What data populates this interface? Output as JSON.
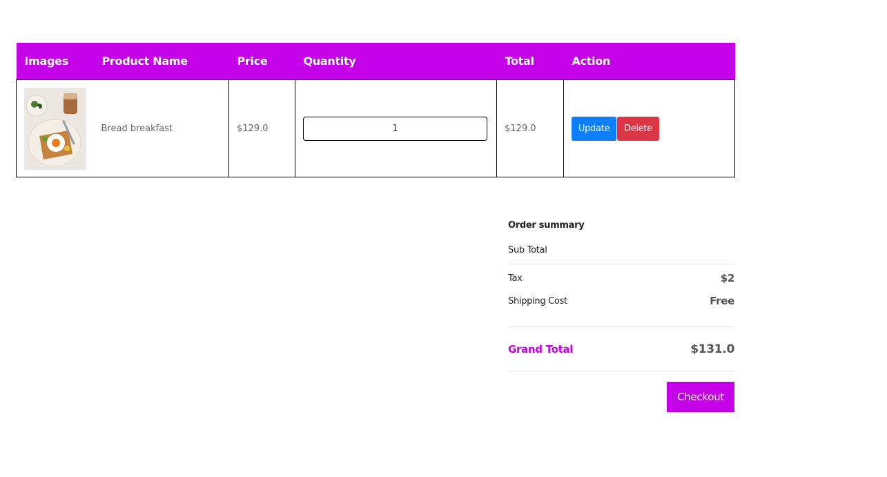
{
  "table": {
    "headers": [
      "Images",
      "Product Name",
      "Price",
      "Quantity",
      "Total",
      "Action"
    ],
    "rows": [
      {
        "image_alt": "Bread breakfast",
        "name": "Bread breakfast",
        "price": "$129.0",
        "quantity": "1",
        "total": "$129.0",
        "update_label": "Update",
        "delete_label": "Delete"
      }
    ]
  },
  "summary": {
    "title": "Order summary",
    "subtotal_label": "Sub Total",
    "subtotal_value": "",
    "tax_label": "Tax",
    "tax_value": "$2",
    "shipping_label": "Shipping Cost",
    "shipping_value": "Free",
    "grand_total_label": "Grand Total",
    "grand_total_value": "$131.0",
    "checkout_label": "Checkout"
  },
  "colors": {
    "brand": "#c400e6",
    "update": "#0d7ffb",
    "delete": "#dc3545"
  }
}
